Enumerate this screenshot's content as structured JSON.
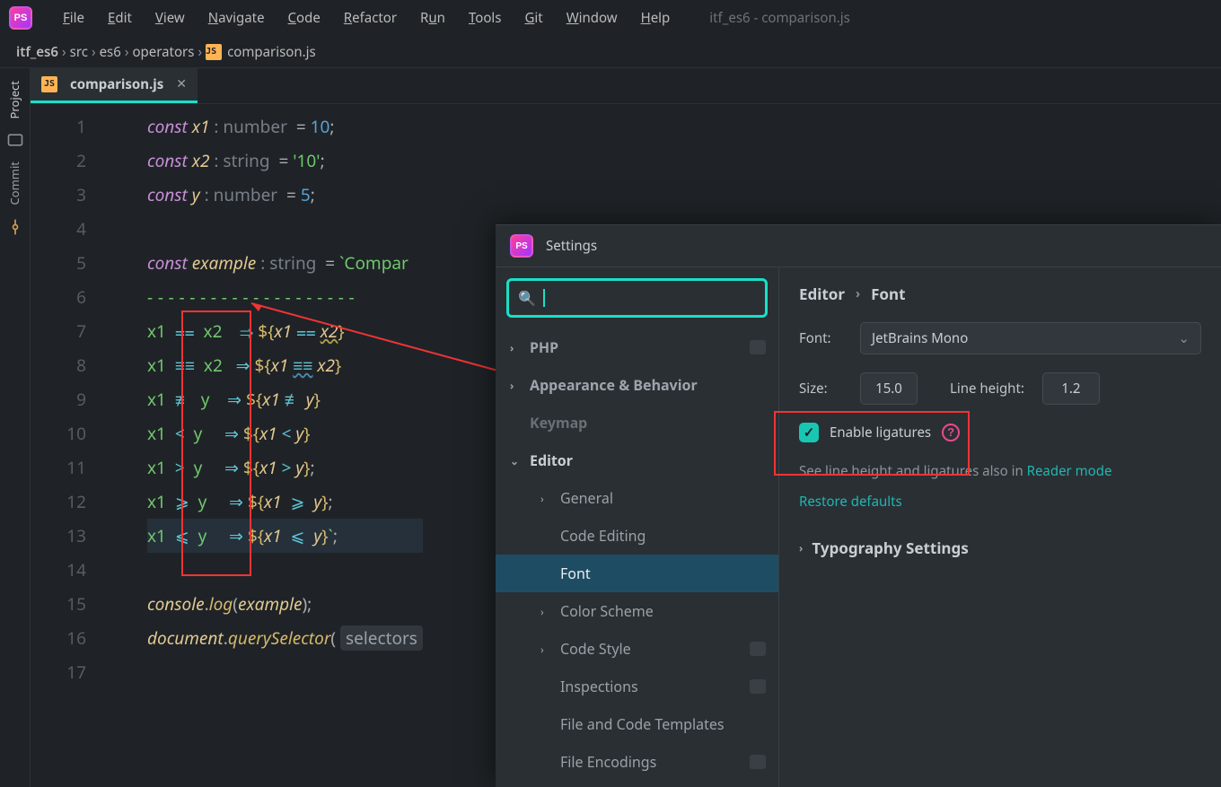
{
  "app": {
    "title": "itf_es6 - comparison.js"
  },
  "menu": [
    "File",
    "Edit",
    "View",
    "Navigate",
    "Code",
    "Refactor",
    "Run",
    "Tools",
    "Git",
    "Window",
    "Help"
  ],
  "breadcrumb": {
    "parts": [
      "itf_es6",
      "src",
      "es6",
      "operators"
    ],
    "file": "comparison.js"
  },
  "sidebar": {
    "tabs": [
      "Project",
      "Commit"
    ]
  },
  "tab": {
    "file": "comparison.js"
  },
  "code": {
    "l1": {
      "kw": "const",
      "id": "x1",
      "hint": ": number",
      "op": "=",
      "val": "10"
    },
    "l2": {
      "kw": "const",
      "id": "x2",
      "hint": ": string",
      "op": "=",
      "val": "'10'"
    },
    "l3": {
      "kw": "const",
      "id": "y",
      "hint": ": number",
      "op": "=",
      "val": "5"
    },
    "l5": {
      "kw": "const",
      "id": "example",
      "hint": ": string",
      "op": "=",
      "start": "`Compar"
    },
    "l6": {
      "dashes": "--------------------"
    },
    "l7": {
      "a": "x1",
      "op": "==",
      "b": "x2",
      "arr": "⇒",
      "ea": "x1",
      "eop": "==",
      "eb": "x2"
    },
    "l8": {
      "a": "x1",
      "op": "===",
      "b": "x2",
      "arr": "⇒",
      "ea": "x1",
      "eop": "===",
      "eb": "x2"
    },
    "l9": {
      "a": "x1",
      "op": "!==",
      "b": "y",
      "arr": "⇒",
      "ea": "x1",
      "eop": "!==",
      "eb": "y"
    },
    "l10": {
      "a": "x1",
      "op": "<",
      "b": "y",
      "arr": "⇒",
      "ea": "x1",
      "eop": "<",
      "eb": "y"
    },
    "l11": {
      "a": "x1",
      "op": ">",
      "b": "y",
      "arr": "⇒",
      "ea": "x1",
      "eop": ">",
      "eb": "y"
    },
    "l12": {
      "a": "x1",
      "op": ">=",
      "b": "y",
      "arr": "⇒",
      "ea": "x1",
      "eop": ">=",
      "eb": "y"
    },
    "l13": {
      "a": "x1",
      "op": "<=",
      "b": "y",
      "arr": "⇒",
      "ea": "x1",
      "eop": "<=",
      "eb": "y",
      "end": "`"
    },
    "l15": {
      "obj": "console",
      "fn": "log",
      "arg": "example"
    },
    "l16": {
      "obj": "document",
      "fn": "querySelector",
      "hint": "selectors"
    },
    "lines": [
      "1",
      "2",
      "3",
      "4",
      "5",
      "6",
      "7",
      "8",
      "9",
      "10",
      "11",
      "12",
      "13",
      "14",
      "15",
      "16",
      "17"
    ]
  },
  "lig": {
    "eq2": "⩵",
    "eq3": "≡≡",
    "neq": "≢",
    "ge": "⩾",
    "le": "⩽"
  },
  "settings": {
    "title": "Settings",
    "placeholder": "",
    "nav": {
      "php": "PHP",
      "ab": "Appearance & Behavior",
      "keymap": "Keymap",
      "editor": "Editor",
      "general": "General",
      "codeediting": "Code Editing",
      "font": "Font",
      "colorscheme": "Color Scheme",
      "codestyle": "Code Style",
      "inspections": "Inspections",
      "fct": "File and Code Templates",
      "fe": "File Encodings"
    },
    "crumb": {
      "a": "Editor",
      "b": "Font"
    },
    "font": {
      "label": "Font:",
      "value": "JetBrains Mono"
    },
    "size": {
      "label": "Size:",
      "value": "15.0"
    },
    "lh": {
      "label": "Line height:",
      "value": "1.2"
    },
    "ligatures": {
      "label": "Enable ligatures",
      "checked": true
    },
    "hint_prefix": "See line height and ligatures also in ",
    "hint_link": "Reader mode",
    "restore": "Restore defaults",
    "typo": "Typography Settings"
  }
}
